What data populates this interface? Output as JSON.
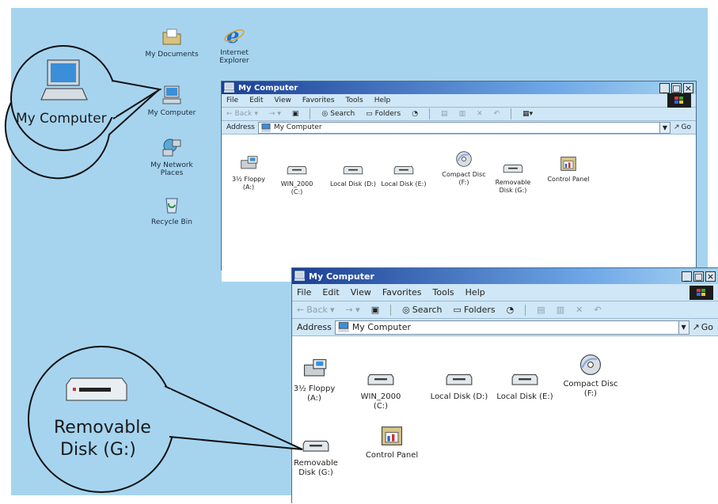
{
  "desktop_icons": [
    {
      "label": "My Documents"
    },
    {
      "label": "Internet Explorer"
    },
    {
      "label": "My Computer"
    },
    {
      "label": "My Network Places"
    },
    {
      "label": "Recycle Bin"
    }
  ],
  "window_small": {
    "title": "My Computer",
    "menu": [
      "File",
      "Edit",
      "View",
      "Favorites",
      "Tools",
      "Help"
    ],
    "toolbar": {
      "back": "Back",
      "search": "Search",
      "folders": "Folders"
    },
    "address_label": "Address",
    "address_value": "My Computer",
    "go": "Go",
    "items": [
      {
        "label": "3½ Floppy (A:)"
      },
      {
        "label": "WIN_2000 (C:)"
      },
      {
        "label": "Local Disk (D:)"
      },
      {
        "label": "Local Disk (E:)"
      },
      {
        "label": "Compact Disc (F:)"
      },
      {
        "label": "Removable Disk (G:)"
      },
      {
        "label": "Control Panel"
      }
    ]
  },
  "window_large": {
    "title": "My Computer",
    "menu": [
      "File",
      "Edit",
      "View",
      "Favorites",
      "Tools",
      "Help"
    ],
    "toolbar": {
      "back": "Back",
      "search": "Search",
      "folders": "Folders"
    },
    "address_label": "Address",
    "address_value": "My Computer",
    "go": "Go",
    "items": [
      {
        "label": "3½ Floppy (A:)"
      },
      {
        "label": "WIN_2000 (C:)"
      },
      {
        "label": "Local Disk (D:)"
      },
      {
        "label": "Local Disk (E:)"
      },
      {
        "label": "Compact Disc (F:)"
      },
      {
        "label": "Removable Disk (G:)"
      },
      {
        "label": "Control Panel"
      }
    ]
  },
  "callouts": {
    "my_computer": "My Computer",
    "removable_line1": "Removable",
    "removable_line2": "Disk (G:)"
  },
  "colors": {
    "desktop": "#a6d4ef",
    "titlebar": "#1b3f94",
    "bars": "#cfe7f6"
  }
}
